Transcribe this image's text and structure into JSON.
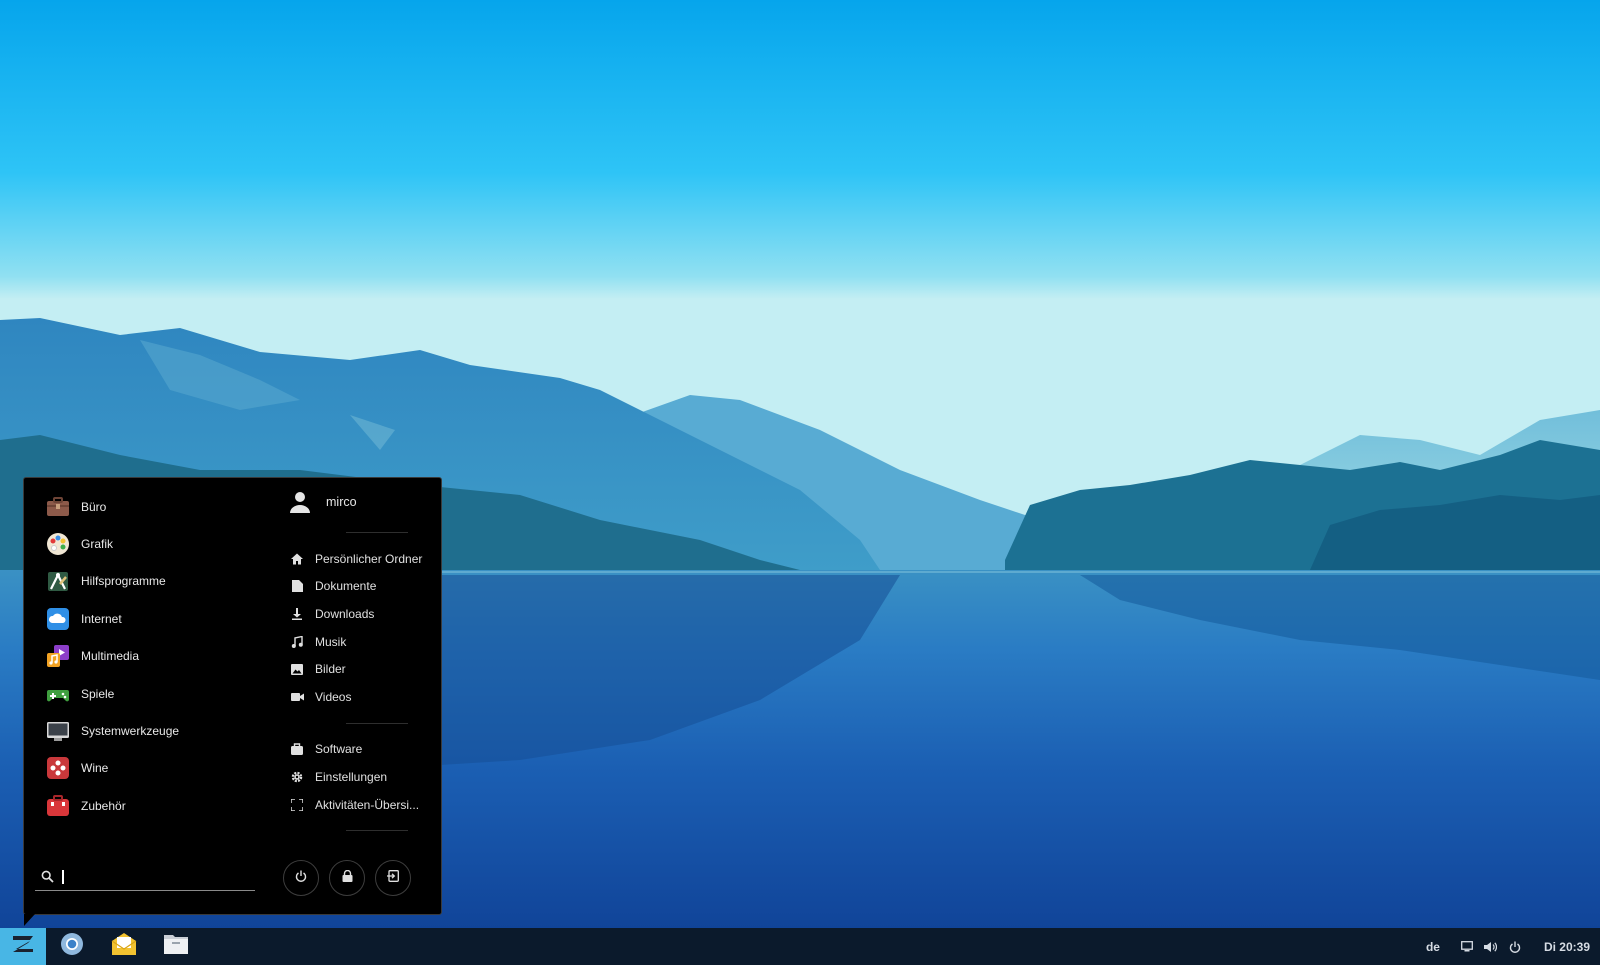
{
  "menu": {
    "categories": [
      {
        "label": "Büro",
        "icon": "briefcase-icon",
        "color": "#8d5a4a"
      },
      {
        "label": "Grafik",
        "icon": "palette-icon",
        "color": "#f1e7d4"
      },
      {
        "label": "Hilfsprogramme",
        "icon": "utilities-icon",
        "color": "#3e6b4b"
      },
      {
        "label": "Internet",
        "icon": "cloud-icon",
        "color": "#2f8fe6"
      },
      {
        "label": "Multimedia",
        "icon": "multimedia-icon",
        "color": "#8c3ec9"
      },
      {
        "label": "Spiele",
        "icon": "gamepad-icon",
        "color": "#3f9f3f"
      },
      {
        "label": "Systemwerkzeuge",
        "icon": "monitor-icon",
        "color": "#4a5058"
      },
      {
        "label": "Wine",
        "icon": "wine-icon",
        "color": "#c9383b"
      },
      {
        "label": "Zubehör",
        "icon": "toolbox-icon",
        "color": "#d9363a"
      }
    ],
    "user": {
      "name": "mirco"
    },
    "places": [
      {
        "label": "Persönlicher Ordner",
        "icon": "home-icon"
      },
      {
        "label": "Dokumente",
        "icon": "document-icon"
      },
      {
        "label": "Downloads",
        "icon": "download-icon"
      },
      {
        "label": "Musik",
        "icon": "music-icon"
      },
      {
        "label": "Bilder",
        "icon": "image-icon"
      },
      {
        "label": "Videos",
        "icon": "video-icon"
      }
    ],
    "system": [
      {
        "label": "Software",
        "icon": "software-icon"
      },
      {
        "label": "Einstellungen",
        "icon": "settings-icon"
      },
      {
        "label": "Aktivitäten-Übersi...",
        "icon": "activities-icon"
      }
    ],
    "search": {
      "value": "",
      "placeholder": ""
    }
  },
  "taskbar": {
    "apps": [
      "chromium-icon",
      "mail-icon",
      "files-icon"
    ],
    "keyboard_layout": "de",
    "clock": "Di 20:39"
  },
  "colors": {
    "accent": "#48b6e5",
    "menu_bg": "#000000",
    "taskbar_bg": "#0b1a2c"
  }
}
